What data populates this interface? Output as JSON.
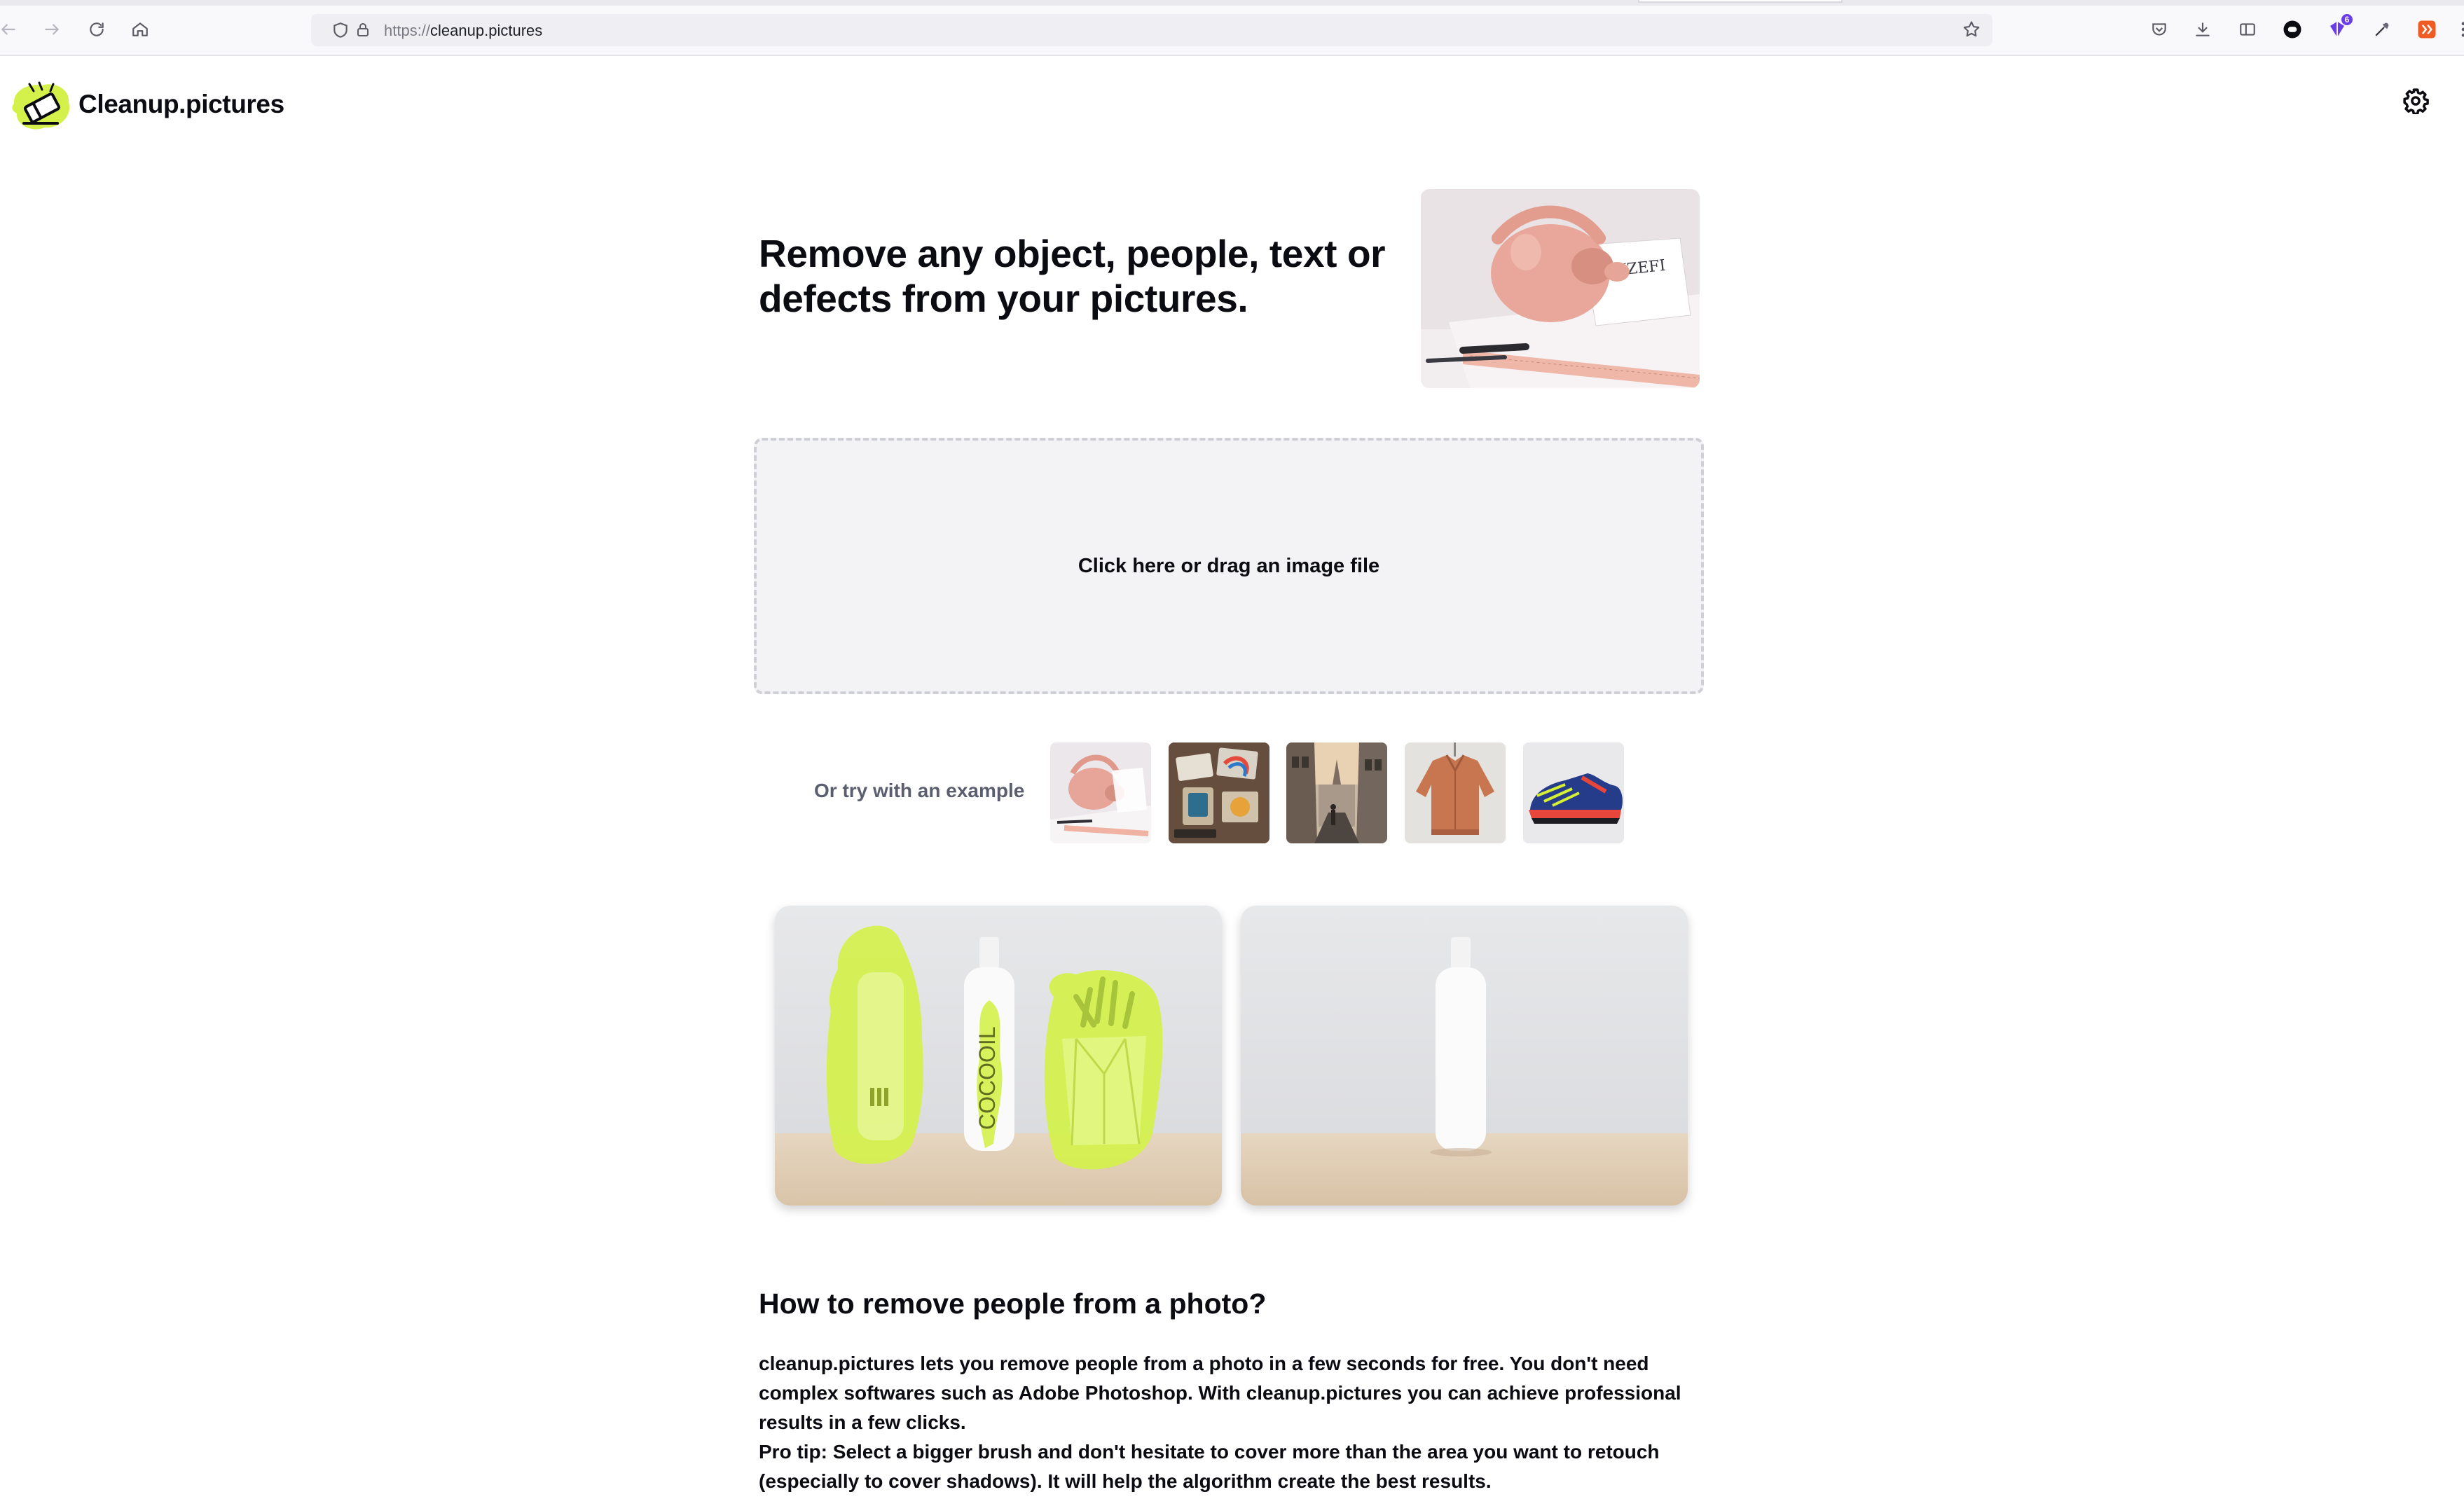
{
  "browser": {
    "url_scheme": "https://",
    "url_host": "cleanup.pictures",
    "extension_badge": "6"
  },
  "app": {
    "brand": "Cleanup.pictures",
    "accent_color": "#d4f14b"
  },
  "hero": {
    "title": "Remove any object, people, text or defects from your pictures."
  },
  "upload": {
    "label": "Click here or drag an image file"
  },
  "examples": {
    "label": "Or try with an example",
    "items": [
      "bag-example",
      "desk-example",
      "street-example",
      "jacket-example",
      "sneaker-example"
    ]
  },
  "comparison": {
    "before_bottle_text": "COCOOIL"
  },
  "article": {
    "title": "How to remove people from a photo?",
    "paragraph": "cleanup.pictures lets you remove people from a photo in a few seconds for free. You don't need complex softwares such as Adobe Photoshop. With cleanup.pictures you can achieve professional results in a few clicks.",
    "pro_tip_label": "Pro tip:",
    "pro_tip_text": " Select a bigger brush and don't hesitate to cover more than the area you want to retouch (especially to cover shadows). It will help the algorithm create the best results."
  }
}
